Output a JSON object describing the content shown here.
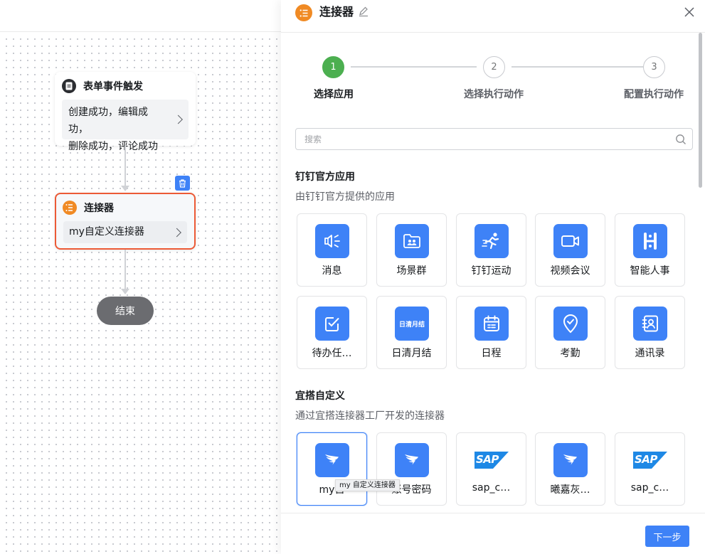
{
  "canvas": {
    "trigger_node": {
      "title": "表单事件触发",
      "body_line1": "创建成功，编辑成功，",
      "body_line2": "删除成功，评论成功"
    },
    "connector_node": {
      "title": "连接器",
      "body": "my自定义连接器"
    },
    "end_node": {
      "label": "结束"
    }
  },
  "drawer": {
    "title": "连接器",
    "steps": [
      {
        "number": "1",
        "label": "选择应用",
        "active": true
      },
      {
        "number": "2",
        "label": "选择执行动作",
        "active": false
      },
      {
        "number": "3",
        "label": "配置执行动作",
        "active": false
      }
    ],
    "search": {
      "placeholder": "搜索",
      "value": ""
    },
    "official": {
      "title": "钉钉官方应用",
      "desc": "由钉钉官方提供的应用",
      "apps": [
        {
          "label": "消息",
          "icon": "speaker-icon"
        },
        {
          "label": "场景群",
          "icon": "group-folder-icon"
        },
        {
          "label": "钉钉运动",
          "icon": "running-icon"
        },
        {
          "label": "视频会议",
          "icon": "video-camera-icon"
        },
        {
          "label": "智能人事",
          "icon": "hr-icon"
        },
        {
          "label": "待办任…",
          "icon": "todo-check-icon"
        },
        {
          "label": "日清月结",
          "icon": "daily-monthly-icon",
          "icon_text": "日清月结"
        },
        {
          "label": "日程",
          "icon": "calendar-icon"
        },
        {
          "label": "考勤",
          "icon": "location-check-icon"
        },
        {
          "label": "通讯录",
          "icon": "contacts-icon"
        }
      ]
    },
    "custom": {
      "title": "宜搭自定义",
      "desc": "通过宜搭连接器工厂开发的连接器",
      "apps": [
        {
          "label": "my自",
          "icon": "dingtalk-logo-icon",
          "selected": true
        },
        {
          "label": "账号密码",
          "icon": "dingtalk-logo-icon"
        },
        {
          "label": "sap_c…",
          "icon": "sap-logo-icon",
          "icon_text": "SAP"
        },
        {
          "label": "曦嘉灰…",
          "icon": "dingtalk-logo-icon"
        },
        {
          "label": "sap_c…",
          "icon": "sap-logo-icon",
          "icon_text": "SAP"
        }
      ]
    },
    "tooltip": "my 自定义连接器",
    "next_button": "下一步"
  },
  "colors": {
    "accent": "#3e82f7",
    "step_done": "#4caf50",
    "connector_orange": "#f08a24",
    "selected_border": "#ec5a36",
    "end_node": "#6b6c70"
  }
}
